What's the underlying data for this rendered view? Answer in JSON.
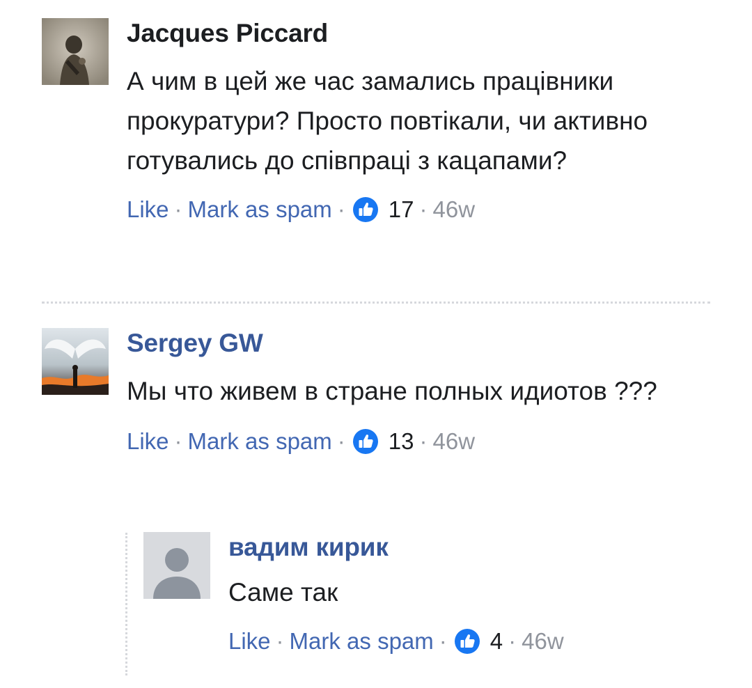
{
  "comments": [
    {
      "author": "Jacques Piccard",
      "author_color": "#1c1e21",
      "text": "А чим в цей же час замались працівники прокуратури? Просто повтікали, чи активно готувались до співпраці з кацапами?",
      "like_label": "Like",
      "spam_label": "Mark as spam",
      "reactions": "17",
      "time": "46w"
    },
    {
      "author": "Sergey GW",
      "author_color": "#385898",
      "text": "Мы что живем в стране полных идиотов ???",
      "like_label": "Like",
      "spam_label": "Mark as spam",
      "reactions": "13",
      "time": "46w",
      "replies": [
        {
          "author": "вадим кирик",
          "author_color": "#385898",
          "text": "Саме так",
          "like_label": "Like",
          "spam_label": "Mark as spam",
          "reactions": "4",
          "time": "46w"
        }
      ]
    }
  ],
  "separator": "·",
  "icons": {
    "like_reaction": "thumbs-up-icon",
    "default_avatar": "person-silhouette-icon"
  },
  "colors": {
    "link": "#4267b2",
    "like_blue": "#1877f2",
    "meta_gray": "#90949c"
  }
}
